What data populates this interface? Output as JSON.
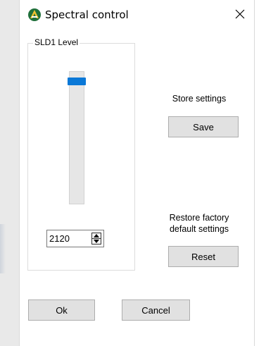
{
  "window": {
    "title": "Spectral control",
    "icon": "spectral-app-icon",
    "close_icon": "close-icon"
  },
  "slider_group": {
    "label": "SLD1 Level",
    "level_value": "2120",
    "slider_level_fraction": 0.95
  },
  "store": {
    "label": "Store settings",
    "button": "Save"
  },
  "restore": {
    "label_line1": "Restore factory",
    "label_line2": "default settings",
    "button": "Reset"
  },
  "footer": {
    "ok": "Ok",
    "cancel": "Cancel"
  },
  "colors": {
    "accent": "#0a78d7",
    "button_face": "#e1e1e1",
    "button_border": "#adadad"
  }
}
